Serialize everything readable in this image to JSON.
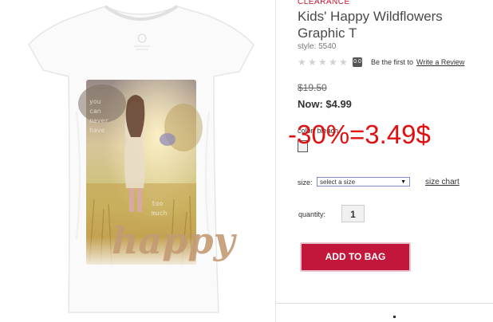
{
  "product": {
    "badge": "CLEARANCE",
    "title": "Kids' Happy Wildflowers Graphic T",
    "style": "style: 5540",
    "rating_score": "0.0",
    "review_prompt": "Be the first to",
    "write_review": "Write a Review",
    "old_price": "$19.50",
    "now_price": "Now: $4.99",
    "color_label": "color: bleach",
    "size_label": "size:",
    "size_placeholder": "select a size",
    "size_chart": "size chart",
    "quantity_label": "quantity:",
    "quantity_value": "1",
    "add_to_bag": "ADD TO BAG"
  },
  "overlay_text": "-30%=3.49$",
  "shirt_print_text": {
    "upper": "you ... on ... here",
    "lower": "too much",
    "script": "happy"
  },
  "colors": {
    "brand_red": "#c2163a",
    "clearance_red": "#c4122f",
    "overlay_red": "#e01010"
  }
}
